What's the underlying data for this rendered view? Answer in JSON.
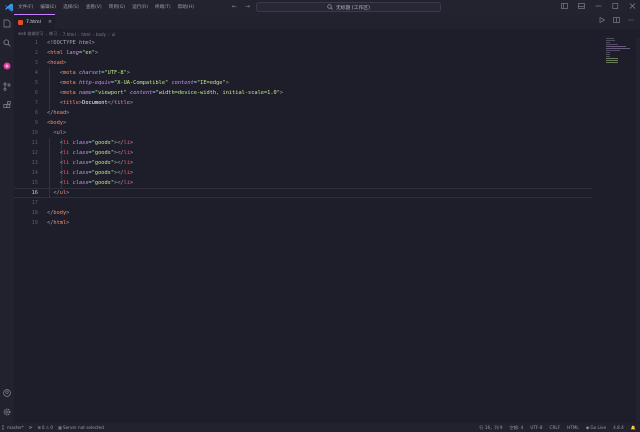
{
  "titlebar": {
    "menu": [
      "文件(F)",
      "编辑(E)",
      "选择(S)",
      "查看(V)",
      "转到(G)",
      "运行(R)",
      "终端(T)",
      "帮助(H)"
    ],
    "command_center": "无标题 (工作区)",
    "nav_back_icon": "arrow-left-icon",
    "nav_forward_icon": "arrow-right-icon"
  },
  "tab": {
    "label": "7.html",
    "close": "×"
  },
  "breadcrumb": [
    "web 前端学习",
    "练习",
    "7.html",
    "html",
    "body",
    "ul"
  ],
  "editor": {
    "current_line": 16,
    "lines": [
      {
        "n": "1"
      },
      {
        "n": "2"
      },
      {
        "n": "3"
      },
      {
        "n": "4"
      },
      {
        "n": "5"
      },
      {
        "n": "6"
      },
      {
        "n": "7"
      },
      {
        "n": "8"
      },
      {
        "n": "9"
      },
      {
        "n": "10"
      },
      {
        "n": "11"
      },
      {
        "n": "12"
      },
      {
        "n": "13"
      },
      {
        "n": "14"
      },
      {
        "n": "15"
      },
      {
        "n": "16"
      },
      {
        "n": "17"
      },
      {
        "n": "18"
      },
      {
        "n": "19"
      }
    ],
    "code": {
      "l1_a": "<!DOCTYPE ",
      "l1_b": "html",
      "l1_c": ">",
      "l2_tag": "html",
      "l2_attr": "lang",
      "l2_val": "\"en\"",
      "l3_tag": "head",
      "l4_tag": "meta",
      "l4_attr": "charset",
      "l4_val": "\"UTF-8\"",
      "l5_tag": "meta",
      "l5_attr1": "http-equiv",
      "l5_val1": "\"X-UA-Compatible\"",
      "l5_attr2": "content",
      "l5_val2": "\"IE=edge\"",
      "l6_tag": "meta",
      "l6_attr1": "name",
      "l6_val1": "\"viewport\"",
      "l6_attr2": "content",
      "l6_val2": "\"width=device-width, initial-scale=1.0\"",
      "l7_tag": "title",
      "l7_text": "Document",
      "l7_close": "title",
      "l8_tag": "head",
      "l9_tag": "body",
      "l10_tag": "ul",
      "li_tag": "li",
      "li_attr": "class",
      "li_val": "\"goods\"",
      "l16_tag": "ul",
      "l18_tag": "body",
      "l19_tag": "html"
    }
  },
  "statusbar": {
    "branch": "master*",
    "sync_icon": "sync-icon",
    "errors": "0",
    "warnings": "0",
    "server": "Server not selected",
    "position": "行 16，列 9",
    "spaces": "空格: 4",
    "encoding": "UTF-8",
    "eol": "CRLF",
    "language": "HTML",
    "go_live": "Go Live",
    "version": "4.8.4"
  },
  "colors": {
    "accent": "#c77dff",
    "tag": "#f78c6c",
    "attr": "#c792ea",
    "string": "#c3e88d"
  }
}
